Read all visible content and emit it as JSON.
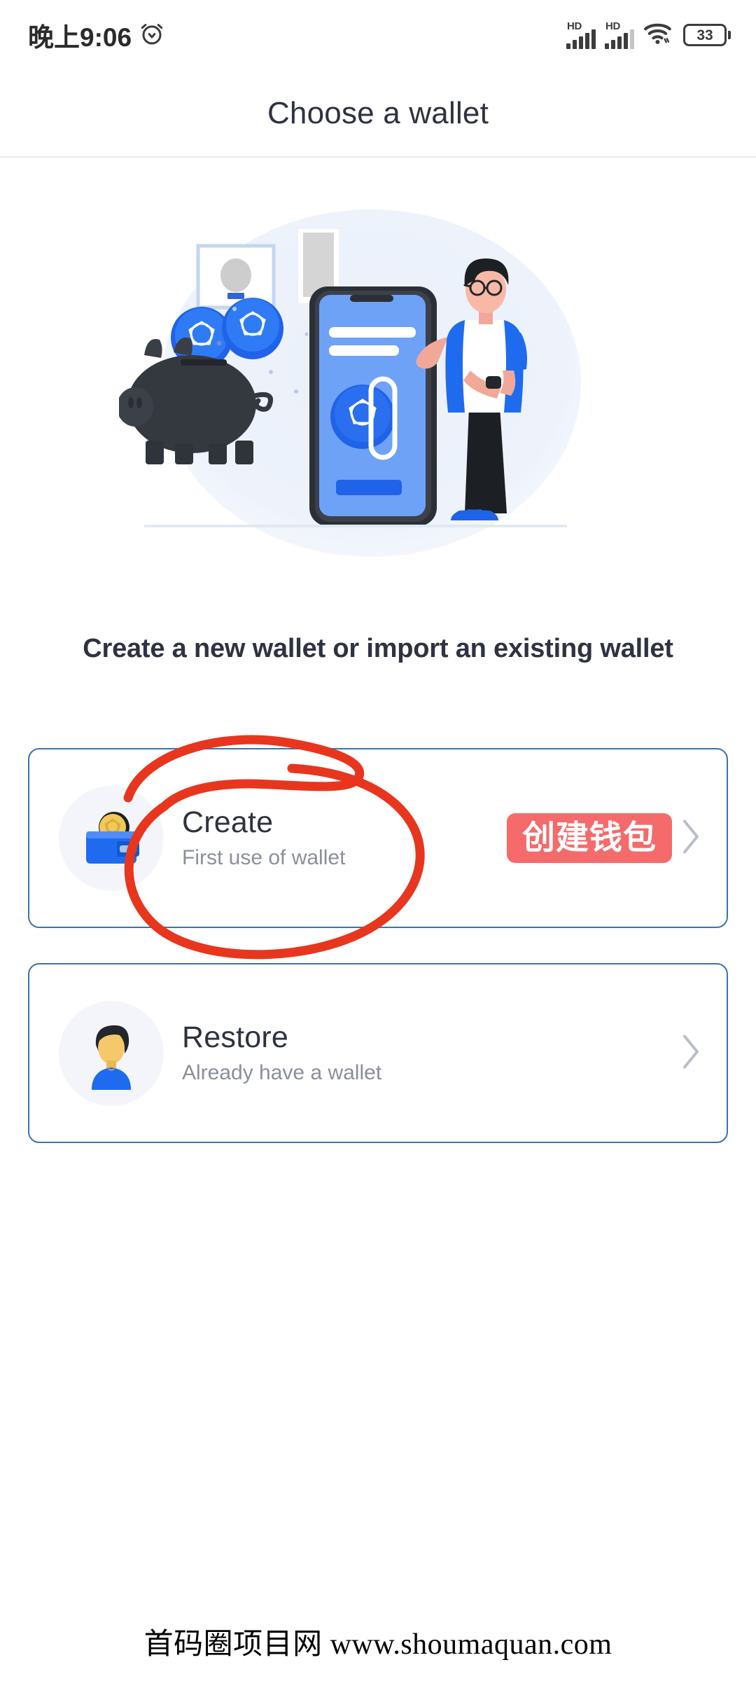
{
  "status_bar": {
    "time": "晚上9:06",
    "alarm_icon": "alarm-clock-icon",
    "signal_1_label": "HD",
    "signal_2_label": "HD",
    "wifi_icon": "wifi-icon",
    "battery_level": "33"
  },
  "header": {
    "title": "Choose a wallet"
  },
  "illustration": {
    "name": "wallet-onboarding-illustration",
    "alt": "Piggy bank with coins, smartphone and man standing"
  },
  "main": {
    "subtitle": "Create a new wallet or import an existing wallet",
    "options": [
      {
        "icon": "wallet-with-coin-icon",
        "title": "Create",
        "subtitle": "First use of wallet",
        "badge": "创建钱包",
        "chevron": "chevron-right-icon",
        "annotated": true
      },
      {
        "icon": "person-avatar-icon",
        "title": "Restore",
        "subtitle": "Already have a wallet",
        "badge": "",
        "chevron": "chevron-right-icon",
        "annotated": false
      }
    ]
  },
  "annotation": {
    "shape": "hand-drawn-ellipse",
    "color": "#e8361e",
    "targets": "create-option-card"
  },
  "watermark": {
    "text": "首码圈项目网 www.shoumaquan.com"
  },
  "colors": {
    "accent_blue": "#1f6bf0",
    "card_border": "#3d72ab",
    "badge_red": "#f56a6a",
    "annotation_red": "#e8361e",
    "title_text": "#2e3241",
    "muted_text": "#8b8f99"
  }
}
